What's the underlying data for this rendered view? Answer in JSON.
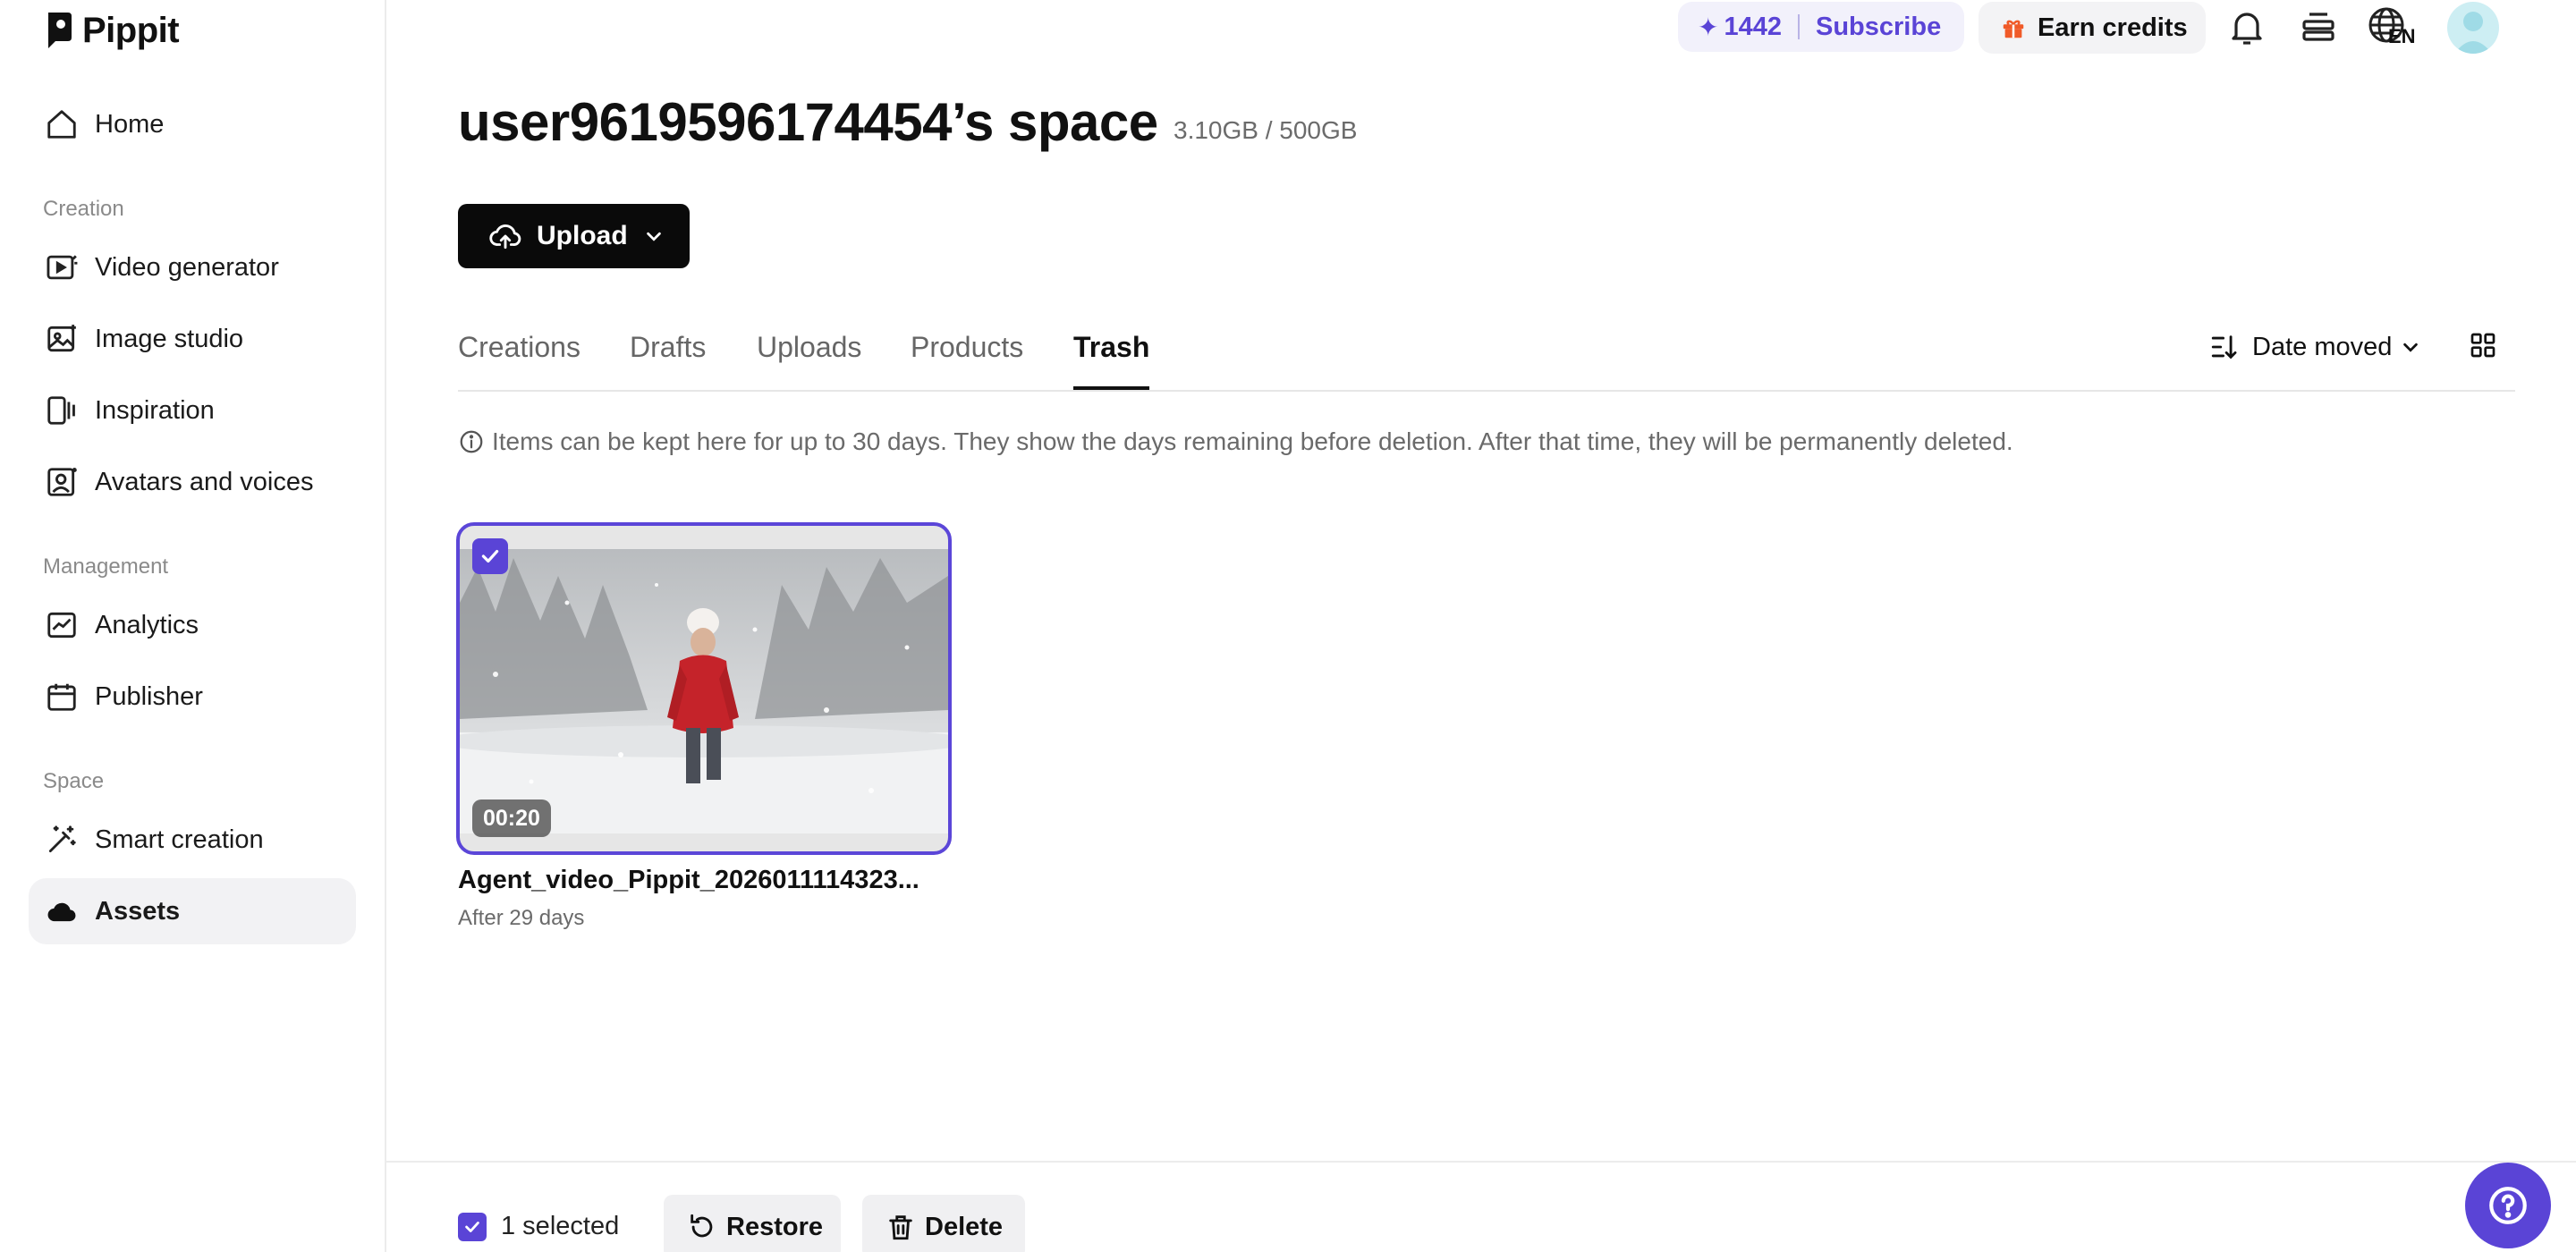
{
  "brand": {
    "name": "Pippit"
  },
  "sidebar": {
    "home": "Home",
    "sections": {
      "creation": "Creation",
      "management": "Management",
      "space": "Space"
    },
    "creation_items": [
      "Video generator",
      "Image studio",
      "Inspiration",
      "Avatars and voices"
    ],
    "management_items": [
      "Analytics",
      "Publisher"
    ],
    "space_items": [
      "Smart creation",
      "Assets"
    ],
    "active_item": "Assets"
  },
  "topbar": {
    "credits": "1442",
    "subscribe_label": "Subscribe",
    "earn_credits_label": "Earn credits",
    "language": "EN"
  },
  "main": {
    "title": "user9619596174454’s space",
    "storage": "3.10GB / 500GB",
    "upload_label": "Upload",
    "tabs": [
      "Creations",
      "Drafts",
      "Uploads",
      "Products",
      "Trash"
    ],
    "active_tab": "Trash",
    "sort_label": "Date moved",
    "info_text": "Items can be kept here for up to 30 days. They show the days remaining before deletion. After that time, they will be permanently deleted."
  },
  "items": [
    {
      "title": "Agent_video_Pippit_2026011114323...",
      "subtitle": "After 29 days",
      "duration": "00:20",
      "selected": true
    }
  ],
  "bottom_bar": {
    "selected_text": "1 selected",
    "restore_label": "Restore",
    "delete_label": "Delete"
  },
  "colors": {
    "accent": "#5a44d6",
    "accent_bg": "#f2f1fb",
    "active_nav_bg": "#f2f2f4",
    "gift": "#f05a28"
  }
}
